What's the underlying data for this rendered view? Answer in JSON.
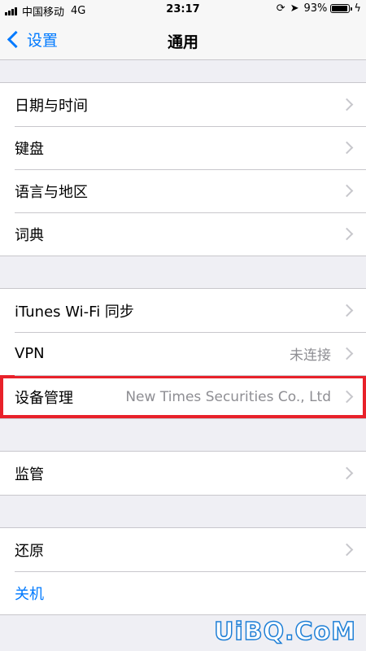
{
  "status_bar": {
    "carrier": "中国移动",
    "network": "4G",
    "time": "23:17",
    "battery_percent_text": "93%",
    "battery_level": 0.93
  },
  "nav": {
    "back_label": "设置",
    "title": "通用"
  },
  "groups": [
    {
      "rows": [
        {
          "label": "日期与时间",
          "detail": ""
        },
        {
          "label": "键盘",
          "detail": ""
        },
        {
          "label": "语言与地区",
          "detail": ""
        },
        {
          "label": "词典",
          "detail": ""
        }
      ]
    },
    {
      "rows": [
        {
          "label": "iTunes Wi-Fi 同步",
          "detail": ""
        },
        {
          "label": "VPN",
          "detail": "未连接"
        },
        {
          "label": "设备管理",
          "detail": "New Times Securities Co., Ltd",
          "highlighted": true
        }
      ]
    },
    {
      "rows": [
        {
          "label": "监管",
          "detail": ""
        }
      ]
    },
    {
      "rows": [
        {
          "label": "还原",
          "detail": ""
        },
        {
          "label": "关机",
          "detail": ""
        }
      ]
    }
  ],
  "watermark": "UiBQ.CoM",
  "colors": {
    "accent": "#007aff",
    "highlight_border": "#e8212a",
    "background": "#efeff4",
    "detail_text": "#8e8e93"
  }
}
